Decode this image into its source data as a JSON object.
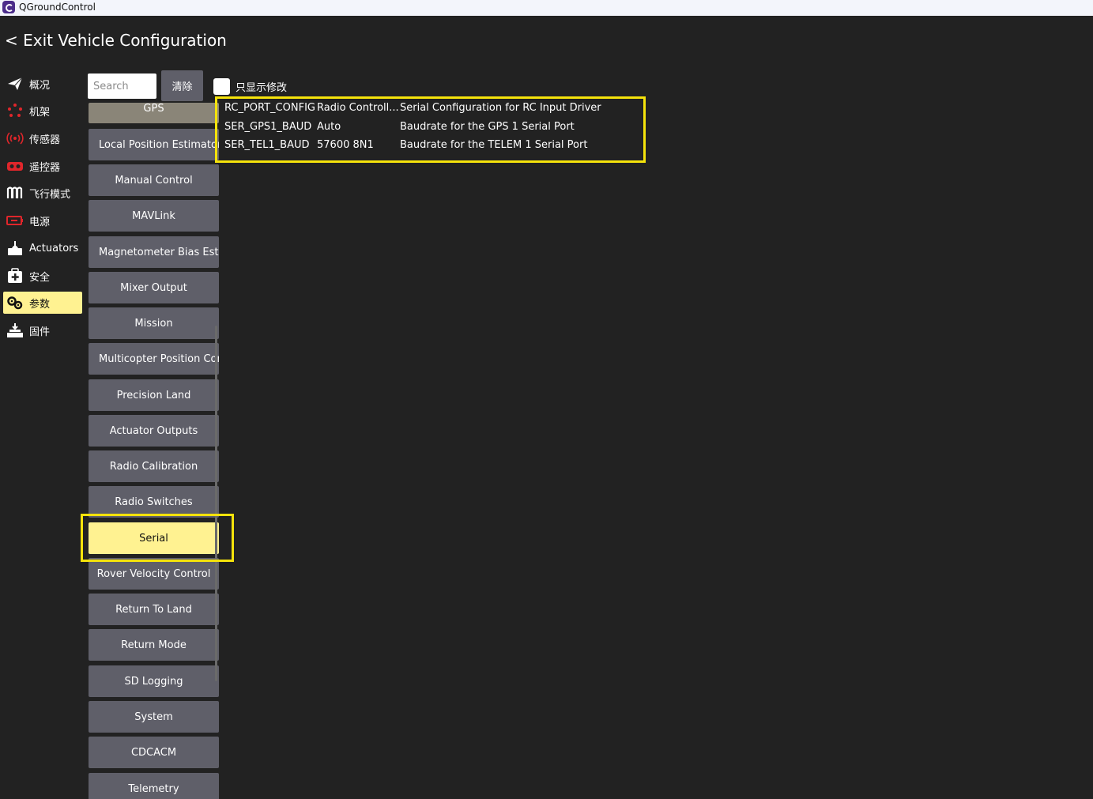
{
  "window": {
    "title": "QGroundControl"
  },
  "header": {
    "exit_label": "< Exit Vehicle Configuration"
  },
  "sidebar": {
    "items": [
      {
        "label": "概况",
        "icon": "paper-plane-icon"
      },
      {
        "label": "机架",
        "icon": "airframe-icon"
      },
      {
        "label": "传感器",
        "icon": "sensor-icon"
      },
      {
        "label": "遥控器",
        "icon": "radio-icon"
      },
      {
        "label": "飞行模式",
        "icon": "flight-modes-icon"
      },
      {
        "label": "电源",
        "icon": "battery-icon"
      },
      {
        "label": "Actuators",
        "icon": "actuators-icon"
      },
      {
        "label": "安全",
        "icon": "safety-icon"
      },
      {
        "label": "参数",
        "icon": "parameters-icon"
      },
      {
        "label": "固件",
        "icon": "firmware-icon"
      }
    ],
    "active_index": 8
  },
  "toolbar": {
    "search_placeholder": "Search",
    "clear_label": "清除",
    "show_modified_label": "只显示修改"
  },
  "groups": [
    "GPS",
    "Local Position Estimator",
    "Manual Control",
    "MAVLink",
    "Magnetometer Bias Estimator",
    "Mixer Output",
    "Mission",
    "Multicopter Position Control",
    "Precision Land",
    "Actuator Outputs",
    "Radio Calibration",
    "Radio Switches",
    "Serial",
    "Rover Velocity Control",
    "Return To Land",
    "Return Mode",
    "SD Logging",
    "System",
    "CDCACM",
    "Telemetry"
  ],
  "selected_group": "Serial",
  "params": [
    {
      "name": "RC_PORT_CONFIG",
      "value": "Radio Controll...",
      "description": "Serial Configuration for RC Input Driver"
    },
    {
      "name": "SER_GPS1_BAUD",
      "value": "Auto",
      "description": "Baudrate for the GPS 1 Serial Port"
    },
    {
      "name": "SER_TEL1_BAUD",
      "value": "57600 8N1",
      "description": "Baudrate for the TELEM 1 Serial Port"
    }
  ],
  "colors": {
    "background": "#222222",
    "button": "#5f5f69",
    "selected": "#fff291",
    "highlight": "#f5e30b"
  }
}
